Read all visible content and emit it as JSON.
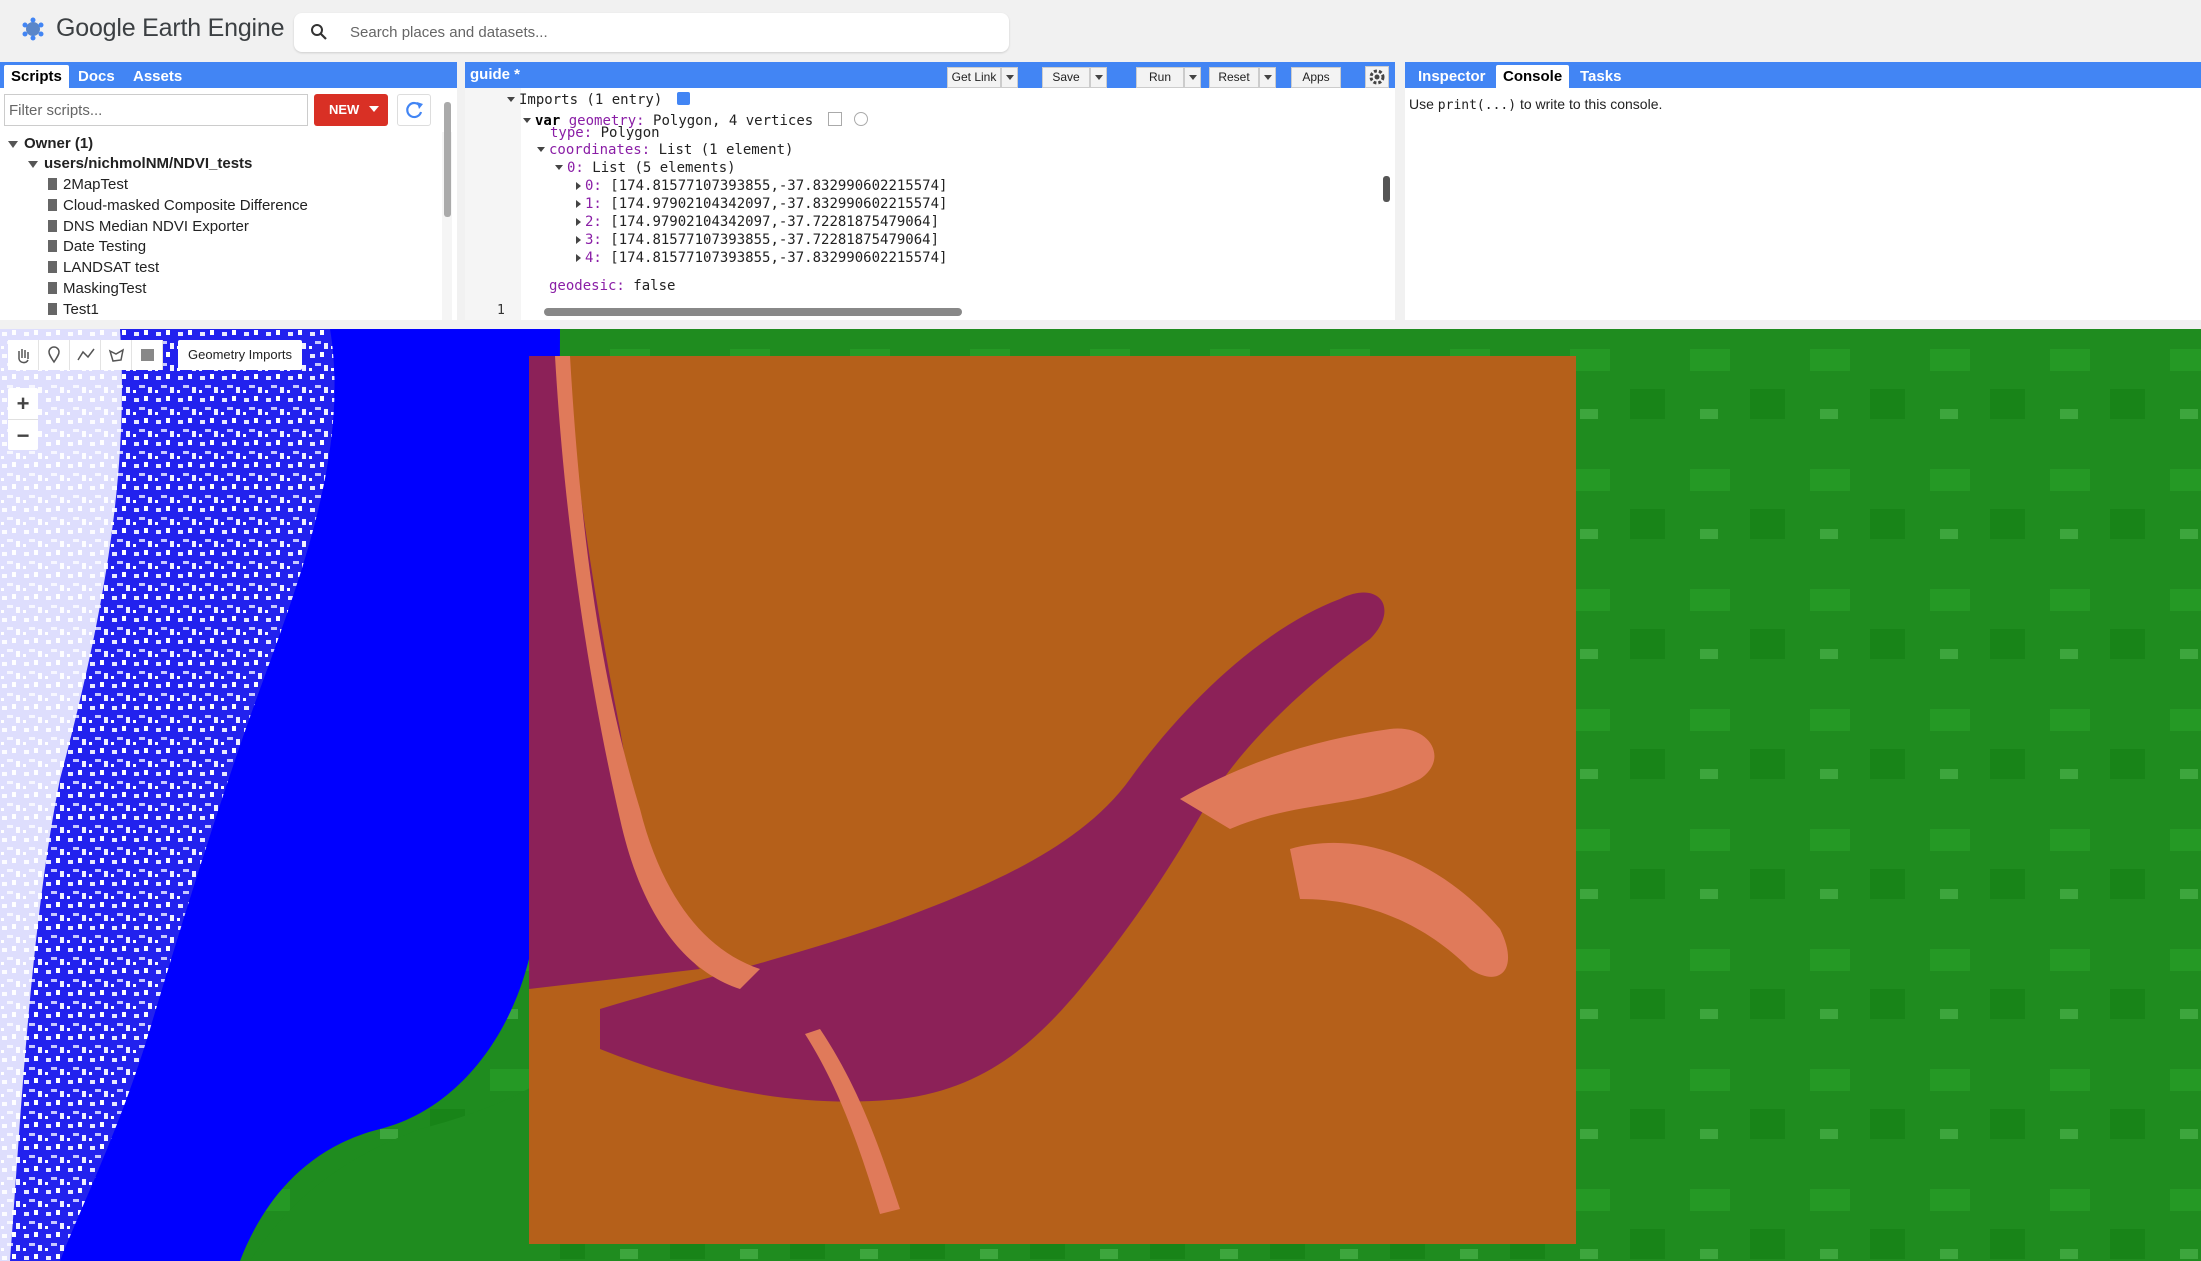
{
  "app": {
    "title": "Google Earth Engine"
  },
  "search": {
    "placeholder": "Search places and datasets..."
  },
  "left_panel": {
    "tabs": [
      "Scripts",
      "Docs",
      "Assets"
    ],
    "filter_placeholder": "Filter scripts...",
    "new_label": "NEW",
    "tree": {
      "owner": "Owner (1)",
      "repo": "users/nichmolNM/NDVI_tests",
      "files": [
        "2MapTest",
        "Cloud-masked Composite Difference",
        "DNS Median NDVI Exporter",
        "Date Testing",
        "LANDSAT test",
        "MaskingTest",
        "Test1"
      ]
    }
  },
  "editor": {
    "title": "guide *",
    "buttons": {
      "get_link": "Get Link",
      "save": "Save",
      "run": "Run",
      "reset": "Reset",
      "apps": "Apps"
    },
    "code": {
      "imports": "Imports (1 entry)",
      "var_kw": "var",
      "var_name": "geometry:",
      "var_desc": "Polygon, 4 vertices",
      "type_key": "type:",
      "type_val": "Polygon",
      "coords_key": "coordinates:",
      "coords_val": "List (1 element)",
      "list0_key": "0:",
      "list0_val": "List (5 elements)",
      "points": [
        {
          "k": "0:",
          "v": "[174.81577107393855,-37.832990602215574]"
        },
        {
          "k": "1:",
          "v": "[174.97902104342097,-37.832990602215574]"
        },
        {
          "k": "2:",
          "v": "[174.97902104342097,-37.72281875479064]"
        },
        {
          "k": "3:",
          "v": "[174.81577107393855,-37.72281875479064]"
        },
        {
          "k": "4:",
          "v": "[174.81577107393855,-37.832990602215574]"
        }
      ],
      "geodesic_key": "geodesic:",
      "geodesic_val": "false",
      "line_number": "1"
    }
  },
  "right_panel": {
    "tabs": [
      "Inspector",
      "Console",
      "Tasks"
    ],
    "console_pre": "Use ",
    "console_code": "print(...)",
    "console_post": " to write to this console."
  },
  "map": {
    "geometry_imports_label": "Geometry Imports",
    "zoom_in": "+",
    "zoom_out": "−",
    "colors": {
      "land": "#1f8c1f",
      "water": "#0000ff",
      "overlay": "#b5601a",
      "estuary": "#8c2158",
      "shore": "#e07a5a"
    }
  }
}
